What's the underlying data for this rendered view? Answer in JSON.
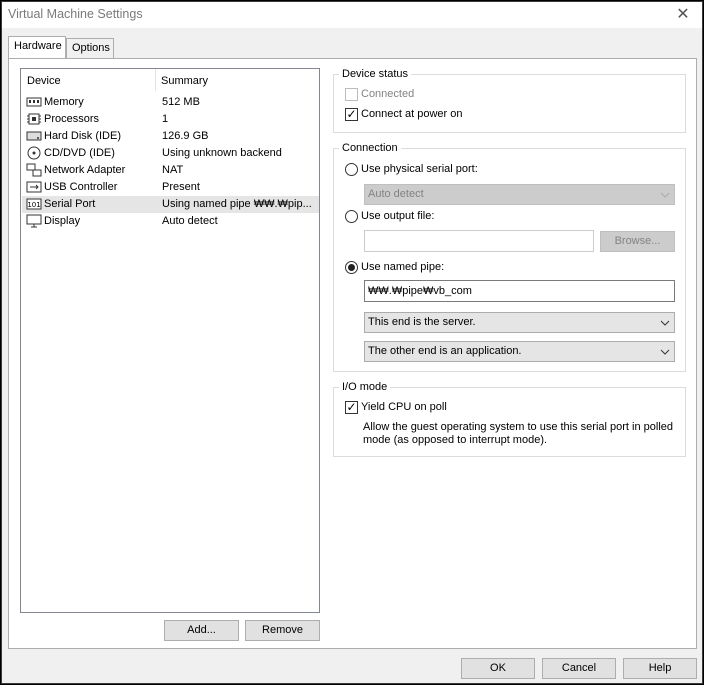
{
  "window": {
    "title": "Virtual Machine Settings"
  },
  "tabs": [
    {
      "label": "Hardware",
      "active": true
    },
    {
      "label": "Options",
      "active": false
    }
  ],
  "device_list": {
    "columns": [
      "Device",
      "Summary"
    ],
    "rows": [
      {
        "icon": "memory-icon",
        "name": "Memory",
        "summary": "512 MB"
      },
      {
        "icon": "processor-icon",
        "name": "Processors",
        "summary": "1"
      },
      {
        "icon": "hard-disk-icon",
        "name": "Hard Disk (IDE)",
        "summary": "126.9 GB"
      },
      {
        "icon": "cd-dvd-icon",
        "name": "CD/DVD (IDE)",
        "summary": "Using unknown backend"
      },
      {
        "icon": "network-adapter-icon",
        "name": "Network Adapter",
        "summary": "NAT"
      },
      {
        "icon": "usb-controller-icon",
        "name": "USB Controller",
        "summary": "Present"
      },
      {
        "icon": "serial-port-icon",
        "name": "Serial Port",
        "summary": "Using named pipe ₩₩.₩pip...",
        "selected": true
      },
      {
        "icon": "display-icon",
        "name": "Display",
        "summary": "Auto detect"
      }
    ],
    "add_label": "Add...",
    "remove_label": "Remove"
  },
  "device_status": {
    "title": "Device status",
    "connected_label": "Connected",
    "connected_checked": false,
    "connected_disabled": true,
    "power_on_label": "Connect at power on",
    "power_on_checked": true
  },
  "connection": {
    "title": "Connection",
    "physical_label": "Use physical serial port:",
    "physical_combo": "Auto detect",
    "output_label": "Use output file:",
    "output_value": "",
    "browse_label": "Browse...",
    "pipe_label": "Use named pipe:",
    "pipe_selected": true,
    "pipe_value": "₩₩.₩pipe₩vb_com",
    "end_combo": "This end is the server.",
    "other_end_combo": "The other end is an application."
  },
  "io_mode": {
    "title": "I/O mode",
    "yield_label": "Yield CPU on poll",
    "yield_checked": true,
    "description": "Allow the guest operating system to use this serial port in polled mode (as opposed to interrupt mode)."
  },
  "footer": {
    "ok_label": "OK",
    "cancel_label": "Cancel",
    "help_label": "Help"
  }
}
